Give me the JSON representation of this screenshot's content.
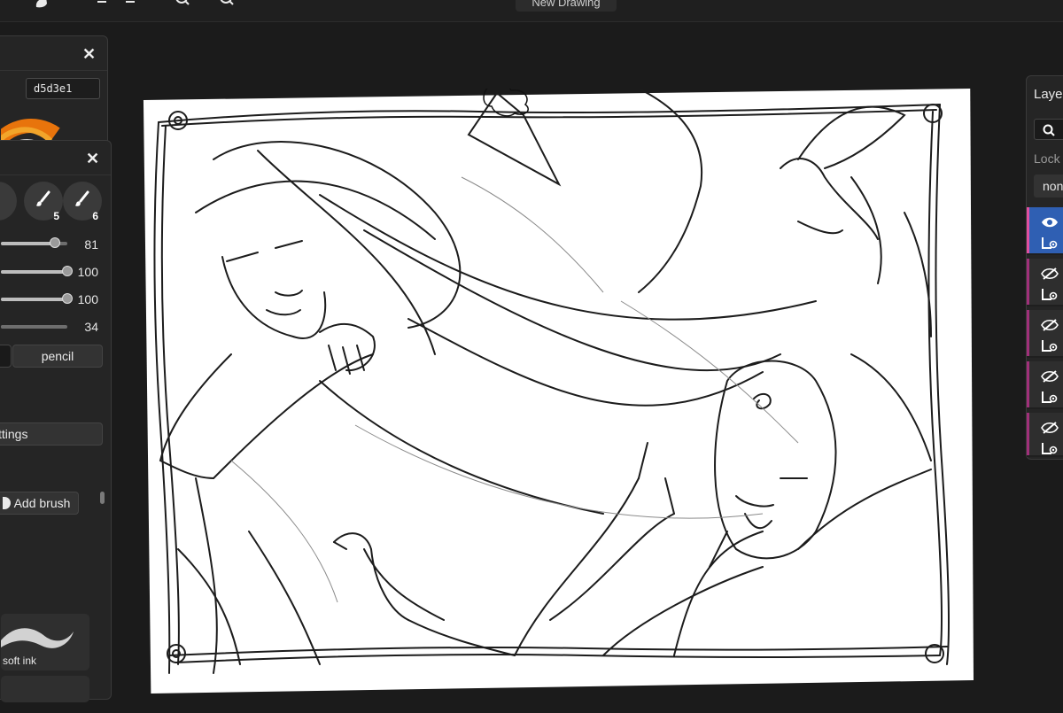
{
  "topbar": {
    "title": "New Drawing",
    "icons": [
      "hand-icon",
      "undo-icon",
      "redo-icon",
      "zoom-in-icon",
      "zoom-out-icon"
    ]
  },
  "color_panel": {
    "hex": "d5d3e1",
    "close": "✕"
  },
  "brush_panel": {
    "close": "✕",
    "slots": [
      {
        "num": "5"
      },
      {
        "num": "6"
      }
    ],
    "sliders": [
      {
        "value": "81",
        "level": 0.81
      },
      {
        "value": "100",
        "level": 1.0
      },
      {
        "value": "100",
        "level": 1.0
      },
      {
        "value": "34",
        "level": 0.34
      }
    ],
    "blend_mode": "pencil",
    "settings_button": "ttings",
    "add_brush_button": "Add brush",
    "brushes": [
      {
        "name": "soft ink"
      }
    ]
  },
  "layers_panel": {
    "title": "Laye",
    "lock_label": "Lock",
    "blend_value": "non",
    "layers": [
      {
        "visible": true,
        "selected": true
      },
      {
        "visible": false
      },
      {
        "visible": false
      },
      {
        "visible": false
      },
      {
        "visible": false
      }
    ]
  },
  "colors": {
    "accent_pink": "#e04fa0",
    "selected_layer": "#2f5fb3",
    "panel": "#252525",
    "background": "#1b1b1b"
  }
}
